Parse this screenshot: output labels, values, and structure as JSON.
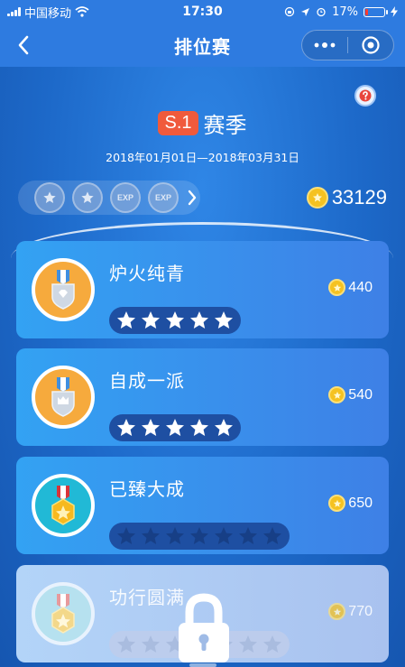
{
  "status_bar": {
    "carrier": "中国移动",
    "time": "17:30",
    "battery": "17%",
    "battery_level": 0.17
  },
  "nav": {
    "title": "排位赛",
    "back_icon": "chevron-left-icon",
    "more_icon": "more-dots-icon",
    "close_icon": "target-circle-icon"
  },
  "season": {
    "badge": "S.1",
    "label": "赛季",
    "dates": "2018年01月01日—2018年03月31日"
  },
  "badges": [
    {
      "icon": "star-badge-icon",
      "text": ""
    },
    {
      "icon": "star-badge-icon",
      "text": ""
    },
    {
      "icon": "exp-badge-icon",
      "text": "EXP"
    },
    {
      "icon": "exp-badge-icon",
      "text": "EXP"
    }
  ],
  "coin_total": "33129",
  "ranks": [
    {
      "title": "炉火纯青",
      "reward": "440",
      "stars_filled": 5,
      "stars_total": 5,
      "medal_color": "#f6aa3d",
      "locked": false
    },
    {
      "title": "自成一派",
      "reward": "540",
      "stars_filled": 5,
      "stars_total": 5,
      "medal_color": "#f6aa3d",
      "locked": false
    },
    {
      "title": "已臻大成",
      "reward": "650",
      "stars_filled": 0,
      "stars_total": 7,
      "medal_color": "#21b9d6",
      "locked": false
    },
    {
      "title": "功行圆满",
      "reward": "770",
      "stars_filled": 0,
      "stars_total": 7,
      "medal_color": "#b6e1ef",
      "locked": true
    }
  ],
  "colors": {
    "accent": "#2e7be0",
    "season_badge": "#f05a3c",
    "coin": "#f5c221",
    "star_filled": "#ffffff",
    "star_empty": "#173f86"
  }
}
